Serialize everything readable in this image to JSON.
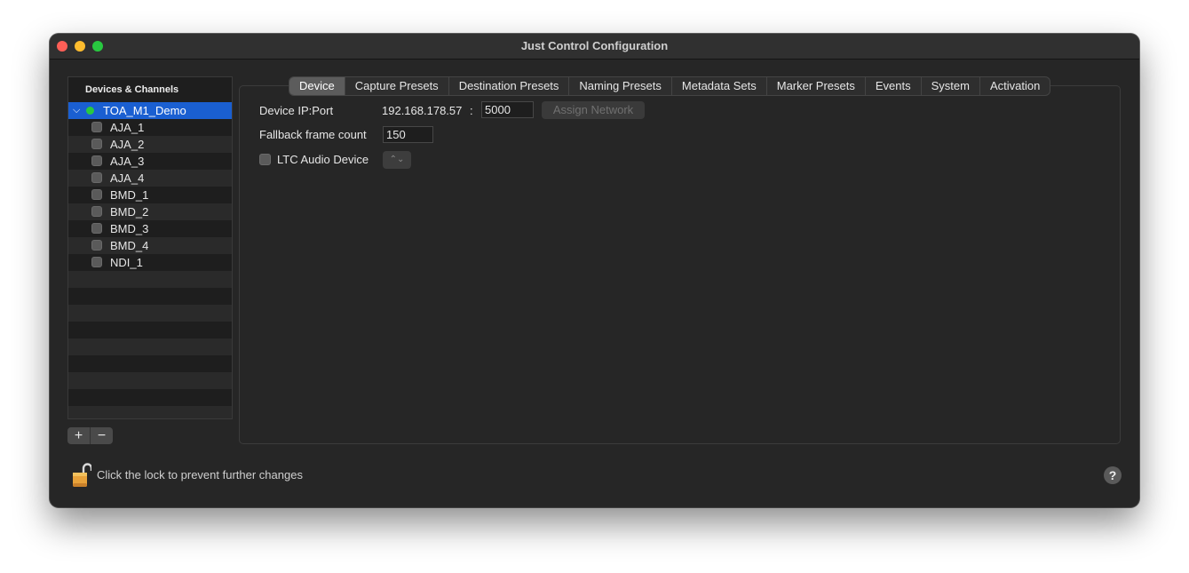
{
  "window": {
    "title": "Just Control Configuration"
  },
  "sidebar": {
    "header": "Devices & Channels",
    "device": {
      "name": "TOA_M1_Demo",
      "status_color": "#29c940",
      "expand_glyph": "⌵"
    },
    "channels": [
      {
        "label": "AJA_1"
      },
      {
        "label": "AJA_2"
      },
      {
        "label": "AJA_3"
      },
      {
        "label": "AJA_4"
      },
      {
        "label": "BMD_1"
      },
      {
        "label": "BMD_2"
      },
      {
        "label": "BMD_3"
      },
      {
        "label": "BMD_4"
      },
      {
        "label": "NDI_1"
      }
    ],
    "add_label": "+",
    "remove_label": "−"
  },
  "tabs": [
    {
      "label": "Device",
      "active": true
    },
    {
      "label": "Capture Presets"
    },
    {
      "label": "Destination Presets"
    },
    {
      "label": "Naming Presets"
    },
    {
      "label": "Metadata Sets"
    },
    {
      "label": "Marker Presets"
    },
    {
      "label": "Events"
    },
    {
      "label": "System"
    },
    {
      "label": "Activation"
    }
  ],
  "device_form": {
    "ip_label": "Device IP:Port",
    "ip_value": "192.168.178.57",
    "colon": ":",
    "port_value": "5000",
    "assign_button": "Assign Network",
    "fallback_label": "Fallback frame count",
    "fallback_value": "150",
    "ltc_label": "LTC Audio Device",
    "ltc_popup_glyph": "⌃⌄"
  },
  "footer": {
    "lock_text": "Click the lock to prevent further changes",
    "help_label": "?"
  },
  "colors": {
    "accent": "#1a5fd1",
    "window_bg": "#262626"
  }
}
